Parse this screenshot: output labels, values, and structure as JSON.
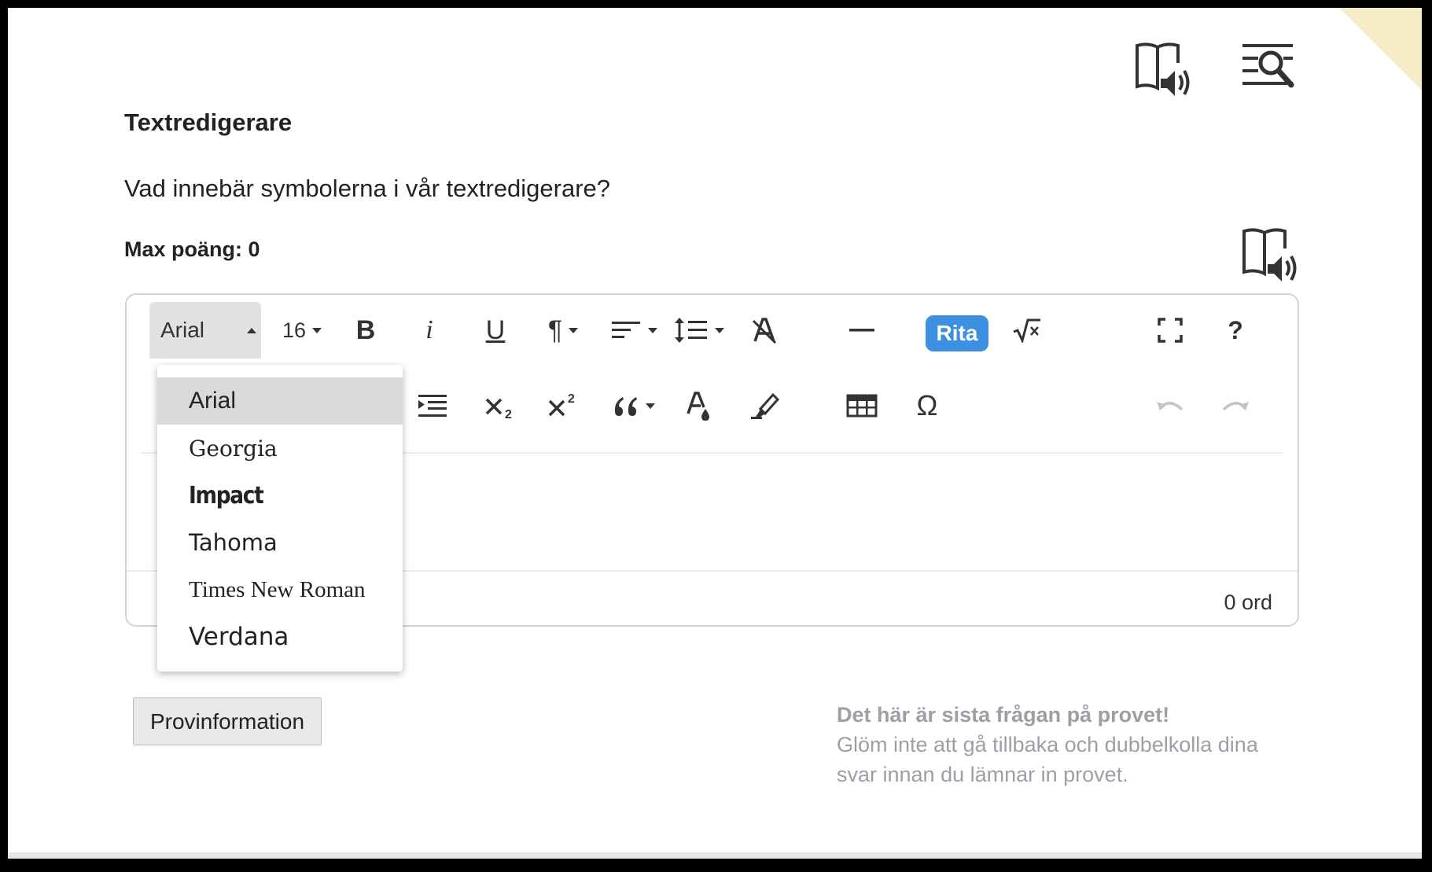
{
  "page": {
    "title": "Textredigerare",
    "question": "Vad innebär symbolerna i vår textredigerare?",
    "max_points": "Max poäng: 0"
  },
  "top_icons": {
    "read_aloud": "book-speaker-icon",
    "text_reader": "text-lines-magnifier-icon"
  },
  "question_icon": "book-speaker-icon",
  "editor": {
    "font_family": "Arial",
    "font_size": "16",
    "toolbar_row1": [
      "bold-icon",
      "italic-icon",
      "underline-icon",
      "paragraph-icon",
      "align-icon",
      "line-height-icon",
      "clear-format-icon",
      "horizontal-line-icon",
      "Rita",
      "sqrt-icon",
      "fullscreen-icon",
      "help-icon"
    ],
    "toolbar_row2": [
      "indent-icon",
      "subscript-icon",
      "superscript-icon",
      "quote-icon",
      "text-color-icon",
      "highlight-icon",
      "table-icon",
      "omega-icon",
      "undo-icon",
      "redo-icon"
    ],
    "bold": "B",
    "italic": "i",
    "underline": "U",
    "paragraph": "¶",
    "rita": "Rita",
    "help": "?",
    "omega": "Ω",
    "word_count": "0 ord",
    "content": ""
  },
  "font_dropdown": {
    "options": [
      "Arial",
      "Georgia",
      "Impact",
      "Tahoma",
      "Times New Roman",
      "Verdana"
    ],
    "selected": "Arial"
  },
  "footer": {
    "provinfo_button": "Provinformation",
    "note_title": "Det här är sista frågan på provet!",
    "note_line1": "Glöm inte att gå tillbaka och dubbelkolla dina",
    "note_line2": "svar innan du lämnar in provet."
  },
  "colors": {
    "accent": "#3d8fe0",
    "note_text": "#9aa0a6",
    "corner_fold": "#f7ecc7"
  }
}
